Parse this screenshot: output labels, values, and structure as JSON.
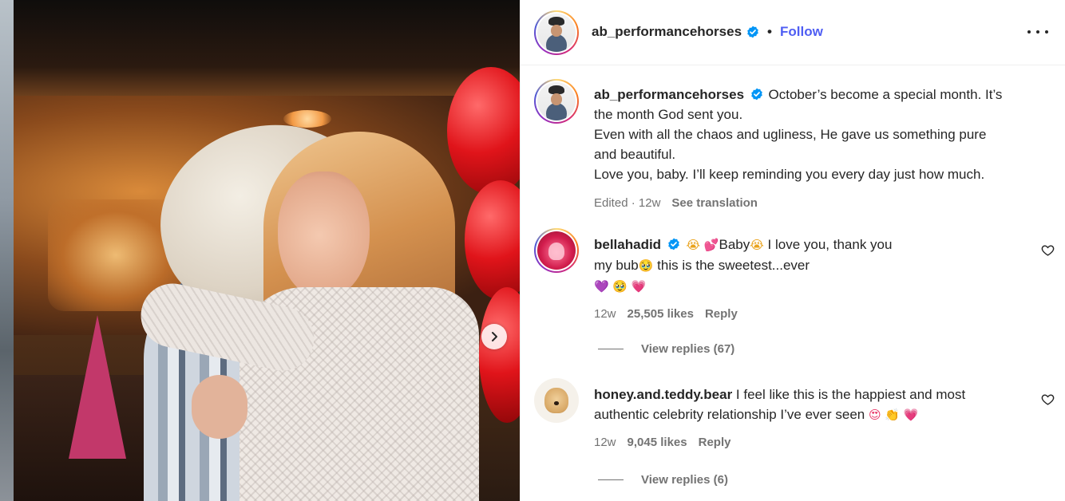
{
  "post": {
    "username": "ab_performancehorses",
    "separator": "•",
    "follow_label": "Follow",
    "caption_lines": [
      "October’s become a special month. It’s",
      "the month God sent you.",
      "Even with all the chaos and ugliness, He gave us something pure",
      "and beautiful.",
      "Love you, baby. I’ll keep reminding you every day just how much."
    ],
    "caption_meta": {
      "edited": "Edited",
      "dot": "·",
      "age": "12w",
      "translation": "See translation"
    }
  },
  "comments": [
    {
      "username": "bellahadid",
      "text_parts": [
        "Baby",
        "I love you, thank you",
        "my bub",
        "this is the sweetest...ever"
      ],
      "age": "12w",
      "likes": "25,505 likes",
      "reply": "Reply",
      "view_replies": "View replies (67)"
    },
    {
      "username": "honey.and.teddy.bear",
      "text_line1": "I feel like this is the happiest and most",
      "text_line2": "authentic celebrity relationship I’ve ever seen",
      "age": "12w",
      "likes": "9,045 likes",
      "reply": "Reply",
      "view_replies": "View replies (6)"
    }
  ],
  "colors": {
    "accent_link": "#4f5ef3",
    "verified_blue": "#0095f6",
    "secondary_text": "#737373"
  },
  "icons": [
    "verified-badge-icon",
    "more-options-icon",
    "heart-icon",
    "chevron-right-icon"
  ]
}
